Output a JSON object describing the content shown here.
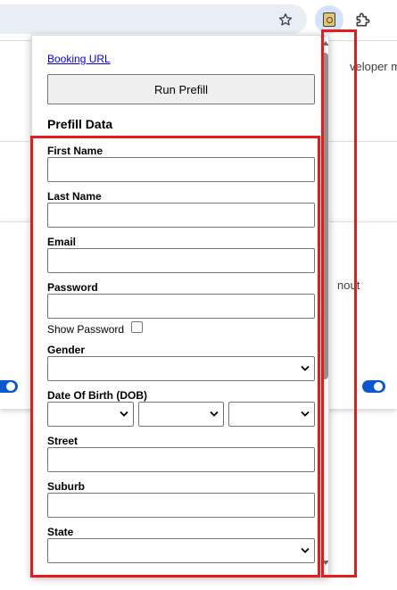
{
  "browser": {
    "star_icon": "star-icon",
    "extension_icon": "extension-badge-icon",
    "extensions_menu_icon": "puzzle-icon"
  },
  "background_page": {
    "text_top_right": "veloper mo",
    "text_card_right": "nout"
  },
  "popup": {
    "booking_link": "Booking URL",
    "run_button": "Run Prefill",
    "section_title": "Prefill Data",
    "fields": {
      "first_name": {
        "label": "First Name",
        "value": ""
      },
      "last_name": {
        "label": "Last Name",
        "value": ""
      },
      "email": {
        "label": "Email",
        "value": ""
      },
      "password": {
        "label": "Password",
        "value": ""
      },
      "show_password": {
        "label": "Show Password",
        "checked": false
      },
      "gender": {
        "label": "Gender",
        "value": ""
      },
      "dob": {
        "label": "Date Of Birth (DOB)",
        "day": "",
        "month": "",
        "year": ""
      },
      "street": {
        "label": "Street",
        "value": ""
      },
      "suburb": {
        "label": "Suburb",
        "value": ""
      },
      "state": {
        "label": "State",
        "value": ""
      }
    }
  },
  "annotation": {
    "color": "#e41c1c"
  }
}
